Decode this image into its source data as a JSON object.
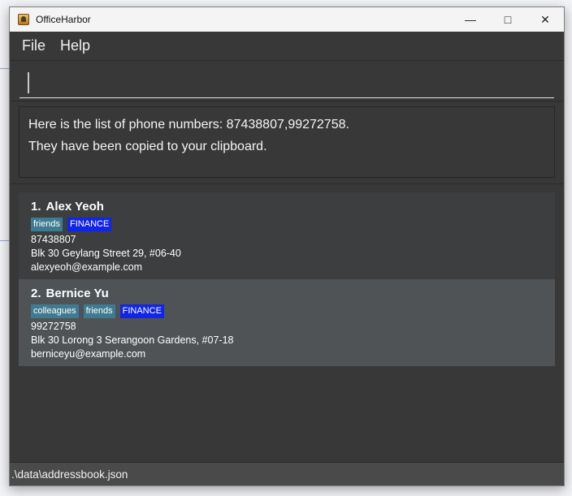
{
  "window": {
    "title": "OfficeHarbor"
  },
  "menu": {
    "items": [
      "File",
      "Help"
    ]
  },
  "command": {
    "value": ""
  },
  "result": {
    "lines": [
      "Here is the list of phone numbers: 87438807,99272758.",
      "They have been copied to your clipboard."
    ]
  },
  "persons": [
    {
      "index": "1.",
      "name": "Alex Yeoh",
      "tags": [
        "friends",
        "FINANCE"
      ],
      "phone": "87438807",
      "address": "Blk 30 Geylang Street 29, #06-40",
      "email": "alexyeoh@example.com"
    },
    {
      "index": "2.",
      "name": "Bernice Yu",
      "tags": [
        "colleagues",
        "friends",
        "FINANCE"
      ],
      "phone": "99272758",
      "address": "Blk 30 Lorong 3 Serangoon Gardens, #07-18",
      "email": "berniceyu@example.com"
    }
  ],
  "colors": {
    "tag_default": "#3e7b91",
    "tag_finance": "#1125e8"
  },
  "status": {
    "path": ".\\data\\addressbook.json"
  }
}
